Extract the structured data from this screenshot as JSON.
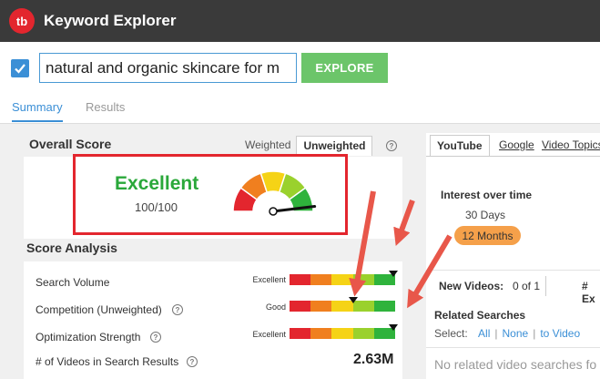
{
  "app": {
    "logo_text": "tb",
    "title": "Keyword Explorer"
  },
  "search": {
    "value": "natural and organic skincare for m",
    "explore_label": "EXPLORE",
    "checked": true
  },
  "main_tabs": [
    {
      "label": "Summary",
      "active": true
    },
    {
      "label": "Results",
      "active": false
    }
  ],
  "overall_score": {
    "title": "Overall Score",
    "toggle_weighted": "Weighted",
    "toggle_unweighted": "Unweighted",
    "rating": "Excellent",
    "score": "100/100",
    "gauge_level": 1.0
  },
  "score_analysis": {
    "title": "Score Analysis",
    "rows": [
      {
        "label": "Search Volume",
        "status": "Excellent",
        "level": 0.98,
        "help": false
      },
      {
        "label": "Competition (Unweighted)",
        "status": "Good",
        "level": 0.6,
        "help": true
      },
      {
        "label": "Optimization Strength",
        "status": "Excellent",
        "level": 0.98,
        "help": true
      }
    ],
    "videos_label": "# of Videos in Search Results",
    "videos_value": "2.63M"
  },
  "right_panel": {
    "tabs": [
      {
        "label": "YouTube",
        "active": true
      },
      {
        "label": "Google",
        "active": false
      },
      {
        "label": "Video Topics",
        "active": false
      }
    ],
    "interest_title": "Interest over time",
    "option_30": "30 Days",
    "option_12": "12 Months",
    "new_videos_label": "New Videos:",
    "new_videos_value": "0 of 1",
    "hash_col": "# Ex",
    "related_title": "Related Searches",
    "select_label": "Select:",
    "select_all": "All",
    "select_none": "None",
    "select_to_video": "to Video",
    "no_related": "No related video searches fo"
  },
  "colors": {
    "titlebar": "#3a3a3a",
    "brand_red": "#e3262e",
    "accent_blue": "#3b8fd6",
    "explore_green": "#6cc56a",
    "excellent_green": "#2aa83a",
    "pill_orange": "#f5a04a",
    "annotation_red": "#e8574a",
    "bar_segments": [
      "#e3262e",
      "#f07f1f",
      "#f5d316",
      "#9ad12d",
      "#2fb33c"
    ]
  }
}
